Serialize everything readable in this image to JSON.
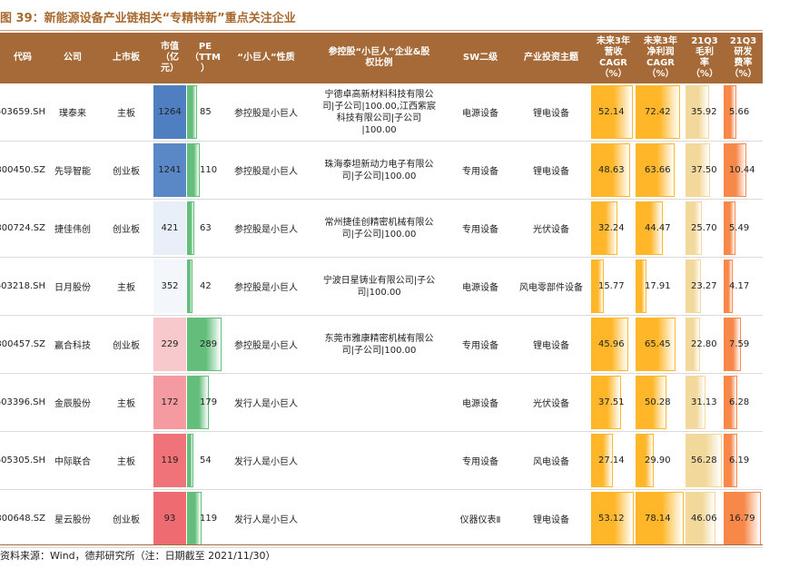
{
  "title": "图 39：新能源设备产业链相关“专精特新”重点关注企业",
  "headers": {
    "code": "代码",
    "company": "公司",
    "board": "上市板",
    "mktcap": "市值\n（亿\n元）",
    "pe": "PE\n（TTM\n）",
    "nature": "“小巨人”性质",
    "holding": "参控股“小巨人”企业&股\n权比例",
    "sw2": "SW二级",
    "theme": "产业投资主题",
    "rev_cagr": "未来3年\n营收\nCAGR\n（%）",
    "np_cagr": "未来3年\n净利润\nCAGR\n（%）",
    "gross": "21Q3\n毛利\n率\n（%）",
    "rd": "21Q3\n研发\n费率\n（%）"
  },
  "rows": [
    {
      "code": "603659.SH",
      "company": "璞泰来",
      "board": "主板",
      "mktcap": "1264",
      "pe": "85",
      "nature": "参控股是小巨人",
      "holding": "宁德卓高新材料科技有限公\n司|子公司|100.00,江西紫宸\n科技有限公司|子公司\n|100.00",
      "sw2": "电源设备",
      "theme": "锂电设备",
      "rev_cagr": "52.14",
      "np_cagr": "72.42",
      "gross": "35.92",
      "rd": "5.66"
    },
    {
      "code": "300450.SZ",
      "company": "先导智能",
      "board": "创业板",
      "mktcap": "1241",
      "pe": "110",
      "nature": "参控股是小巨人",
      "holding": "珠海泰坦新动力电子有限公\n司|子公司|100.00",
      "sw2": "专用设备",
      "theme": "锂电设备",
      "rev_cagr": "48.63",
      "np_cagr": "63.66",
      "gross": "37.50",
      "rd": "10.44"
    },
    {
      "code": "300724.SZ",
      "company": "捷佳伟创",
      "board": "创业板",
      "mktcap": "421",
      "pe": "63",
      "nature": "参控股是小巨人",
      "holding": "常州捷佳创精密机械有限公\n司|子公司|100.00",
      "sw2": "专用设备",
      "theme": "光伏设备",
      "rev_cagr": "32.24",
      "np_cagr": "44.47",
      "gross": "25.70",
      "rd": "5.49"
    },
    {
      "code": "603218.SH",
      "company": "日月股份",
      "board": "主板",
      "mktcap": "352",
      "pe": "42",
      "nature": "参控股是小巨人",
      "holding": "宁波日星铸业有限公司|子公\n司|100.00",
      "sw2": "电源设备",
      "theme": "风电零部件设备",
      "rev_cagr": "15.77",
      "np_cagr": "17.91",
      "gross": "23.27",
      "rd": "4.17"
    },
    {
      "code": "300457.SZ",
      "company": "赢合科技",
      "board": "创业板",
      "mktcap": "229",
      "pe": "289",
      "nature": "参控股是小巨人",
      "holding": "东莞市雅康精密机械有限公\n司|子公司|100.00",
      "sw2": "专用设备",
      "theme": "锂电设备",
      "rev_cagr": "45.96",
      "np_cagr": "65.45",
      "gross": "22.80",
      "rd": "7.59"
    },
    {
      "code": "603396.SH",
      "company": "金辰股份",
      "board": "主板",
      "mktcap": "172",
      "pe": "179",
      "nature": "发行人是小巨人",
      "holding": "",
      "sw2": "电源设备",
      "theme": "光伏设备",
      "rev_cagr": "37.51",
      "np_cagr": "50.28",
      "gross": "31.13",
      "rd": "6.28"
    },
    {
      "code": "605305.SH",
      "company": "中际联合",
      "board": "主板",
      "mktcap": "119",
      "pe": "54",
      "nature": "发行人是小巨人",
      "holding": "",
      "sw2": "专用设备",
      "theme": "风电设备",
      "rev_cagr": "27.14",
      "np_cagr": "29.90",
      "gross": "56.28",
      "rd": "6.19"
    },
    {
      "code": "300648.SZ",
      "company": "星云股份",
      "board": "创业板",
      "mktcap": "93",
      "pe": "119",
      "nature": "发行人是小巨人",
      "holding": "",
      "sw2": "仪器仪表Ⅱ",
      "theme": "锂电设备",
      "rev_cagr": "53.12",
      "np_cagr": "78.14",
      "gross": "46.06",
      "rd": "16.79"
    }
  ],
  "mktcap_colors": [
    "#4f7fc0",
    "#5a88c6",
    "#e9eff9",
    "#f3f6fb",
    "#f8c9cc",
    "#f59aa0",
    "#ef7378",
    "#ee6b71"
  ],
  "colors": {
    "pe_bar": "#63be7b",
    "growth_bar": "#ffb628",
    "gross_bar": "#f2d89a",
    "rd_bar": "#f7884a",
    "header_bg": "#a56a37"
  },
  "source": "资料来源：Wind，德邦研究所（注：日期截至 2021/11/30）"
}
